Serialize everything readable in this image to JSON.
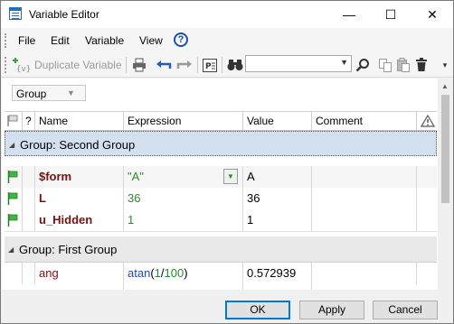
{
  "window": {
    "title": "Variable Editor",
    "minimize": "—",
    "maximize": "☐",
    "close": "✕"
  },
  "menu": {
    "items": [
      "File",
      "Edit",
      "Variable",
      "View"
    ],
    "help": "?"
  },
  "toolbar": {
    "duplicate_label": "Duplicate Variable",
    "search_value": ""
  },
  "group_by": {
    "selected": "Group"
  },
  "columns": [
    "?",
    "Name",
    "Expression",
    "Value",
    "Comment"
  ],
  "groups": [
    {
      "title": "Group: Second Group",
      "rows": [
        {
          "name": "$form",
          "expression": "\"A\"",
          "value": "A"
        },
        {
          "name": "L",
          "expression": "36",
          "value": "36"
        },
        {
          "name": "u_Hidden",
          "expression": "1",
          "value": "1"
        }
      ]
    },
    {
      "title": "Group: First Group",
      "rows": [
        {
          "name": "ang",
          "expression_fn": "atan",
          "expression_open": "(",
          "expression_a": "1",
          "expression_op": "/",
          "expression_b": "100",
          "expression_close": ")",
          "value": "0.572939"
        }
      ]
    }
  ],
  "buttons": {
    "ok": "OK",
    "apply": "Apply",
    "cancel": "Cancel"
  },
  "colors": {
    "accent": "#0078d7",
    "flag_green": "#2ea82e",
    "selected_group": "#d2e0f0"
  }
}
